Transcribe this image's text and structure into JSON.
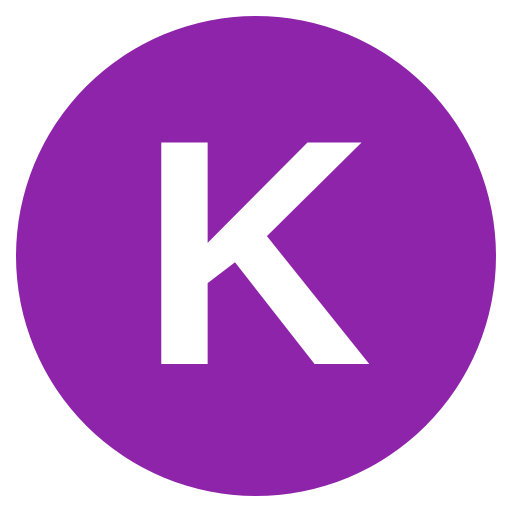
{
  "avatar": {
    "initial": "K",
    "background_color": "#8E24AA",
    "text_color": "#FFFFFF",
    "shape": "circle"
  }
}
